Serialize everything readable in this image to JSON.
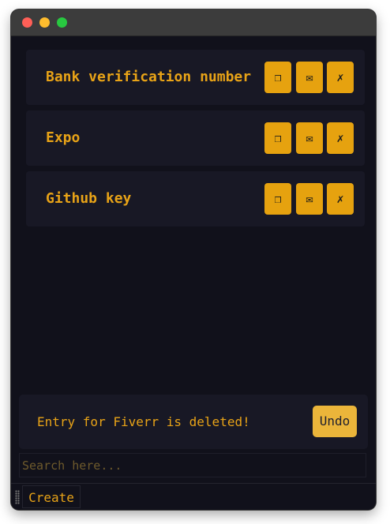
{
  "window": {
    "controls": [
      "close",
      "minimize",
      "maximize"
    ]
  },
  "entries": [
    {
      "label": "Bank verification number",
      "copy_icon": "❐",
      "mail_icon": "✉",
      "delete_icon": "✗"
    },
    {
      "label": "Expo",
      "copy_icon": "❐",
      "mail_icon": "✉",
      "delete_icon": "✗"
    },
    {
      "label": "Github key",
      "copy_icon": "❐",
      "mail_icon": "✉",
      "delete_icon": "✗"
    }
  ],
  "toast": {
    "message": "Entry for Fiverr is deleted!",
    "undo_label": "Undo"
  },
  "search": {
    "placeholder": "Search here...",
    "value": ""
  },
  "footer": {
    "create_label": "Create"
  },
  "colors": {
    "background": "#11111b",
    "card": "#181825",
    "accent": "#e6a20f",
    "text_accent": "#e8a317"
  }
}
